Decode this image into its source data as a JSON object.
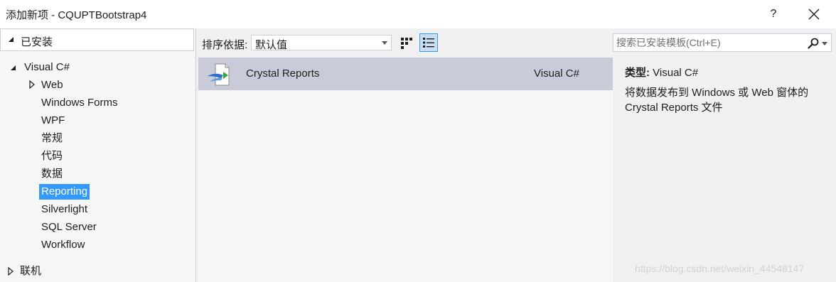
{
  "window": {
    "title": "添加新项 - CQUPTBootstrap4",
    "help_label": "?",
    "close_icon": "close-icon"
  },
  "tree": {
    "installed_label": "已安装",
    "visual_csharp_label": "Visual C#",
    "items": [
      {
        "label": "Web",
        "expandable": true
      },
      {
        "label": "Windows Forms"
      },
      {
        "label": "WPF"
      },
      {
        "label": "常规"
      },
      {
        "label": "代码"
      },
      {
        "label": "数据"
      },
      {
        "label": "Reporting",
        "selected": true
      },
      {
        "label": "Silverlight"
      },
      {
        "label": "SQL Server"
      },
      {
        "label": "Workflow"
      }
    ],
    "online_label": "联机"
  },
  "toolbar": {
    "sort_label": "排序依据:",
    "sort_value": "默认值",
    "view_modes": [
      "grid-view-icon",
      "list-view-icon"
    ],
    "active_view": "list-view-icon"
  },
  "templates": [
    {
      "name": "Crystal Reports",
      "language": "Visual C#",
      "icon": "crystal-reports-icon",
      "selected": true
    }
  ],
  "search": {
    "placeholder": "搜索已安装模板(Ctrl+E)",
    "value": ""
  },
  "details": {
    "type_key": "类型:",
    "type_value": "Visual C#",
    "description": "将数据发布到 Windows 或 Web 窗体的 Crystal Reports 文件"
  },
  "watermark": "https://blog.csdn.net/weixin_44548147",
  "colors": {
    "selection": "#3399ff",
    "selected_row": "#c9cbd9",
    "panel_border": "#cccedb"
  }
}
